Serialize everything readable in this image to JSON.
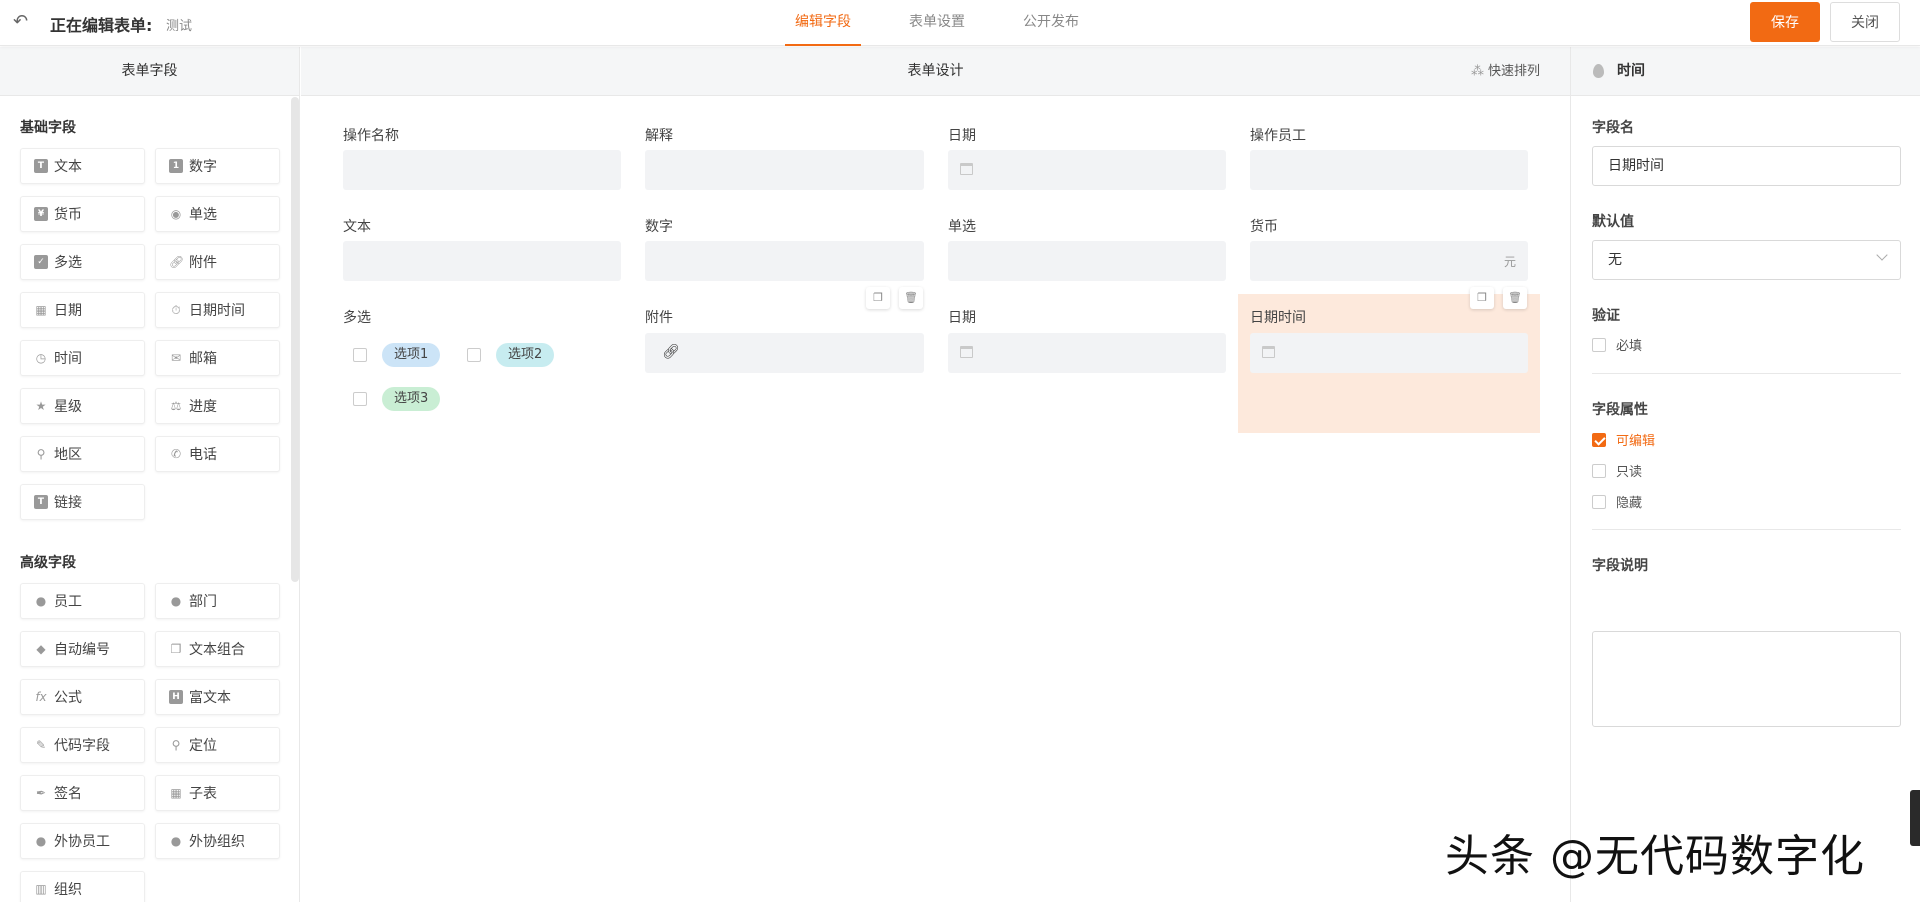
{
  "header": {
    "title": "正在编辑表单:",
    "subtitle": "测试",
    "tabs": [
      "编辑字段",
      "表单设置",
      "公开发布"
    ],
    "save": "保存",
    "close": "关闭",
    "accent": "#f26a13"
  },
  "left": {
    "title": "表单字段",
    "basic_title": "基础字段",
    "basic": [
      "文本",
      "数字",
      "货币",
      "单选",
      "多选",
      "附件",
      "日期",
      "日期时间",
      "时间",
      "邮箱",
      "星级",
      "进度",
      "地区",
      "电话",
      "链接"
    ],
    "advanced_title": "高级字段",
    "advanced": [
      "员工",
      "部门",
      "自动编号",
      "文本组合",
      "公式",
      "富文本",
      "代码字段",
      "定位",
      "签名",
      "子表",
      "外协员工",
      "外协组织",
      "组织"
    ]
  },
  "center": {
    "title": "表单设计",
    "quick": "快速排列",
    "fields": [
      "操作名称",
      "解释",
      "日期",
      "操作员工",
      "文本",
      "数字",
      "单选",
      "货币",
      "多选",
      "附件",
      "日期",
      "日期时间"
    ],
    "currency_unit": "元",
    "options": [
      "选项1",
      "选项2",
      "选项3"
    ]
  },
  "right": {
    "title": "时间",
    "name_label": "字段名",
    "name_value": "日期时间",
    "default_label": "默认值",
    "default_value": "无",
    "valid_label": "验证",
    "required": "必填",
    "attr_label": "字段属性",
    "attrs": [
      "可编辑",
      "只读",
      "隐藏"
    ],
    "desc_label": "字段说明"
  },
  "watermark": "头条 @无代码数字化"
}
